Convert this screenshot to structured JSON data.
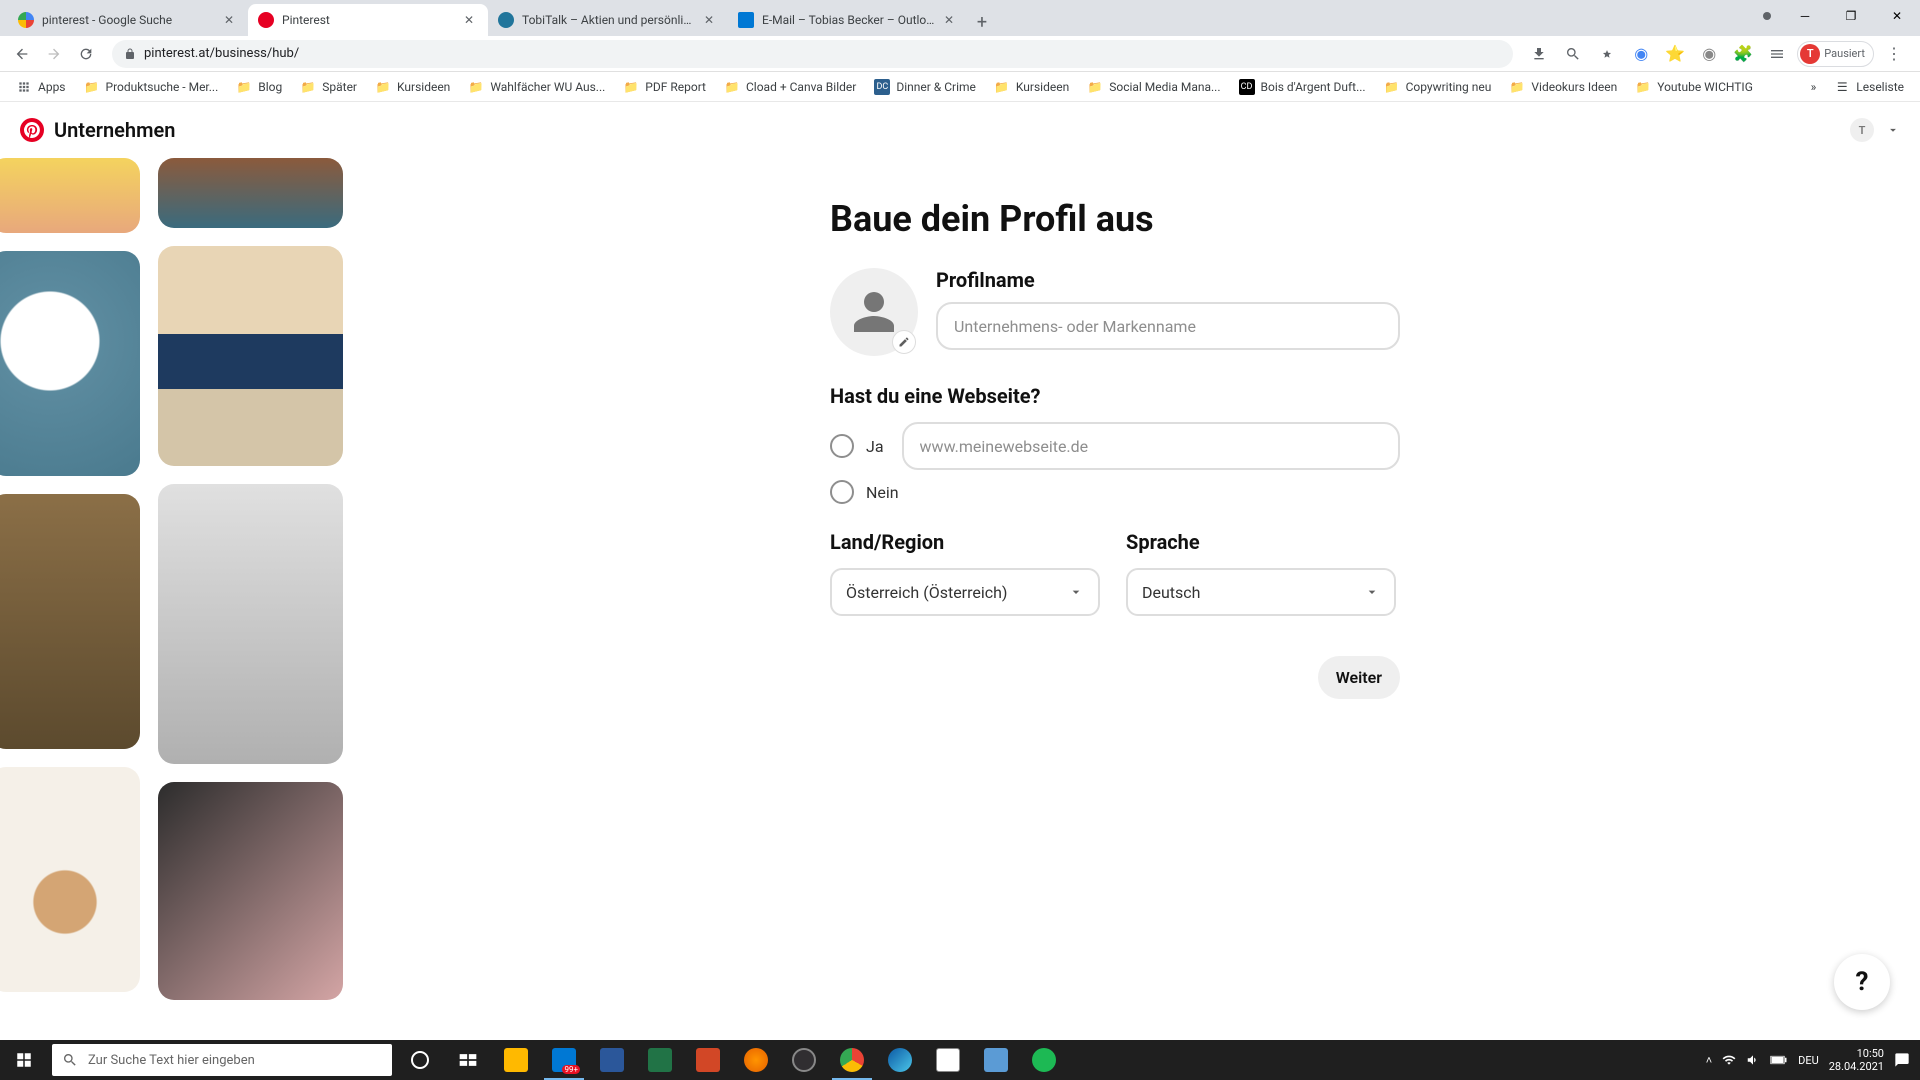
{
  "browser": {
    "tabs": [
      {
        "title": "pinterest - Google Suche",
        "favicon": "google"
      },
      {
        "title": "Pinterest",
        "favicon": "pinterest",
        "active": true
      },
      {
        "title": "TobiTalk – Aktien und persönlich…",
        "favicon": "wp"
      },
      {
        "title": "E-Mail – Tobias Becker – Outlook",
        "favicon": "outlook"
      }
    ],
    "url": "pinterest.at/business/hub/",
    "profile_label": "Pausiert",
    "profile_initial": "T"
  },
  "bookmarks": {
    "apps": "Apps",
    "items": [
      "Produktsuche - Mer...",
      "Blog",
      "Später",
      "Kursideen",
      "Wahlfächer WU Aus...",
      "PDF Report",
      "Cload + Canva Bilder",
      "Dinner & Crime",
      "Kursideen",
      "Social Media Mana...",
      "Bois d'Argent Duft...",
      "Copywriting neu",
      "Videokurs Ideen",
      "Youtube WICHTIG"
    ],
    "reading_list": "Leseliste"
  },
  "pinterest_header": {
    "brand": "Unternehmen",
    "avatar_initial": "T"
  },
  "form": {
    "title": "Baue dein Profil aus",
    "profile_name_label": "Profilname",
    "profile_name_placeholder": "Unternehmens- oder Markenname",
    "website_question": "Hast du eine Webseite?",
    "radio_yes": "Ja",
    "radio_no": "Nein",
    "website_placeholder": "www.meinewebseite.de",
    "country_label": "Land/Region",
    "country_value": "Österreich (Österreich)",
    "language_label": "Sprache",
    "language_value": "Deutsch",
    "next_button": "Weiter"
  },
  "help_fab": "?",
  "taskbar": {
    "search_placeholder": "Zur Suche Text hier eingeben",
    "lang": "DEU",
    "time": "10:50",
    "date": "28.04.2021",
    "badge": "99+"
  }
}
